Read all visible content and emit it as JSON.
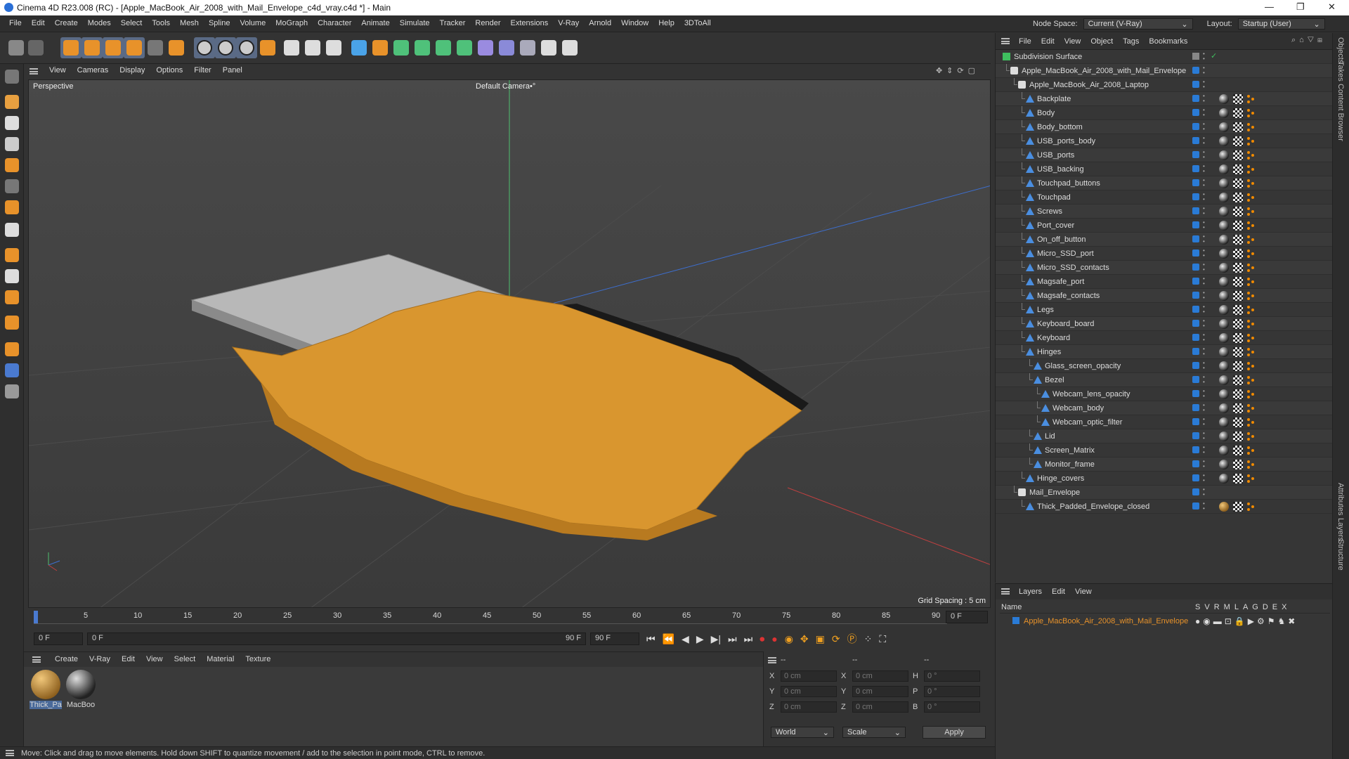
{
  "titlebar": {
    "title": "Cinema 4D R23.008 (RC) - [Apple_MacBook_Air_2008_with_Mail_Envelope_c4d_vray.c4d *] - Main",
    "minimize": "—",
    "maximize": "❐",
    "close": "✕"
  },
  "menubar": {
    "items": [
      "File",
      "Edit",
      "Create",
      "Modes",
      "Select",
      "Tools",
      "Mesh",
      "Spline",
      "Volume",
      "MoGraph",
      "Character",
      "Animate",
      "Simulate",
      "Tracker",
      "Render",
      "Extensions",
      "V-Ray",
      "Arnold",
      "Window",
      "Help",
      "3DToAll"
    ],
    "node_space_label": "Node Space:",
    "node_space_value": "Current (V-Ray)",
    "layout_label": "Layout:",
    "layout_value": "Startup (User)"
  },
  "toolbar_icons": [
    "undo-icon",
    "redo-icon",
    "select-icon",
    "move-icon",
    "scale-icon",
    "rotate-icon",
    "recent-icon",
    "transform-icon",
    "x-axis-icon",
    "y-axis-icon",
    "z-axis-icon",
    "coord-system-icon",
    "render-view-icon",
    "render-icon",
    "render-settings-icon",
    "cube-icon",
    "pen-icon",
    "subdivision-icon",
    "extrude-icon",
    "cloner-icon",
    "instance-icon",
    "deformer-icon",
    "field-icon",
    "floor-icon",
    "camera-icon",
    "light-icon"
  ],
  "viewport": {
    "menu": [
      "View",
      "Cameras",
      "Display",
      "Options",
      "Filter",
      "Panel"
    ],
    "label": "Perspective",
    "camera": "Default Camera",
    "camera_suffix": "•°",
    "grid_spacing": "Grid Spacing : 5 cm"
  },
  "timeline": {
    "ticks": [
      "0",
      "5",
      "10",
      "15",
      "20",
      "25",
      "30",
      "35",
      "40",
      "45",
      "50",
      "55",
      "60",
      "65",
      "70",
      "75",
      "80",
      "85",
      "90"
    ],
    "current_frame_right": "0 F",
    "start_field": "0 F",
    "range_start": "0 F",
    "range_end": "90 F",
    "end_field": "90 F"
  },
  "material_manager": {
    "menu": [
      "Create",
      "V-Ray",
      "Edit",
      "View",
      "Select",
      "Material",
      "Texture"
    ],
    "materials": [
      {
        "label": "Thick_Pa",
        "color": "#c78a2e"
      },
      {
        "label": "MacBoo",
        "color": "#555"
      }
    ]
  },
  "coords": {
    "headers": [
      "--",
      "--",
      "--"
    ],
    "rows": [
      {
        "a": "X",
        "av": "0 cm",
        "b": "X",
        "bv": "0 cm",
        "c": "H",
        "cv": "0 °"
      },
      {
        "a": "Y",
        "av": "0 cm",
        "b": "Y",
        "bv": "0 cm",
        "c": "P",
        "cv": "0 °"
      },
      {
        "a": "Z",
        "av": "0 cm",
        "b": "Z",
        "bv": "0 cm",
        "c": "B",
        "cv": "0 °"
      }
    ],
    "world": "World",
    "scale": "Scale",
    "apply": "Apply"
  },
  "statusbar": {
    "text": "Move: Click and drag to move elements. Hold down SHIFT to quantize movement / add to the selection in point mode, CTRL to remove."
  },
  "object_manager": {
    "menu": [
      "File",
      "Edit",
      "View",
      "Object",
      "Tags",
      "Bookmarks"
    ],
    "objects": [
      {
        "name": "Subdivision Surface",
        "indent": 0,
        "type": "subd",
        "tags": "check"
      },
      {
        "name": "Apple_MacBook_Air_2008_with_Mail_Envelope",
        "indent": 1,
        "type": "null",
        "tags": "none"
      },
      {
        "name": "Apple_MacBook_Air_2008_Laptop",
        "indent": 2,
        "type": "null",
        "tags": "none"
      },
      {
        "name": "Backplate",
        "indent": 3,
        "type": "poly",
        "tags": "mat"
      },
      {
        "name": "Body",
        "indent": 3,
        "type": "poly",
        "tags": "mat"
      },
      {
        "name": "Body_bottom",
        "indent": 3,
        "type": "poly",
        "tags": "mat"
      },
      {
        "name": "USB_ports_body",
        "indent": 3,
        "type": "poly",
        "tags": "mat"
      },
      {
        "name": "USB_ports",
        "indent": 3,
        "type": "poly",
        "tags": "mat"
      },
      {
        "name": "USB_backing",
        "indent": 3,
        "type": "poly",
        "tags": "mat"
      },
      {
        "name": "Touchpad_buttons",
        "indent": 3,
        "type": "poly",
        "tags": "mat"
      },
      {
        "name": "Touchpad",
        "indent": 3,
        "type": "poly",
        "tags": "mat"
      },
      {
        "name": "Screws",
        "indent": 3,
        "type": "poly",
        "tags": "mat"
      },
      {
        "name": "Port_cover",
        "indent": 3,
        "type": "poly",
        "tags": "mat"
      },
      {
        "name": "On_off_button",
        "indent": 3,
        "type": "poly",
        "tags": "mat"
      },
      {
        "name": "Micro_SSD_port",
        "indent": 3,
        "type": "poly",
        "tags": "mat"
      },
      {
        "name": "Micro_SSD_contacts",
        "indent": 3,
        "type": "poly",
        "tags": "mat"
      },
      {
        "name": "Magsafe_port",
        "indent": 3,
        "type": "poly",
        "tags": "mat"
      },
      {
        "name": "Magsafe_contacts",
        "indent": 3,
        "type": "poly",
        "tags": "mat"
      },
      {
        "name": "Legs",
        "indent": 3,
        "type": "poly",
        "tags": "mat"
      },
      {
        "name": "Keyboard_board",
        "indent": 3,
        "type": "poly",
        "tags": "mat"
      },
      {
        "name": "Keyboard",
        "indent": 3,
        "type": "poly",
        "tags": "mat"
      },
      {
        "name": "Hinges",
        "indent": 3,
        "type": "poly",
        "tags": "mat"
      },
      {
        "name": "Glass_screen_opacity",
        "indent": 4,
        "type": "poly",
        "tags": "mat"
      },
      {
        "name": "Bezel",
        "indent": 4,
        "type": "poly",
        "tags": "mat"
      },
      {
        "name": "Webcam_lens_opacity",
        "indent": 5,
        "type": "poly",
        "tags": "mat"
      },
      {
        "name": "Webcam_body",
        "indent": 5,
        "type": "poly",
        "tags": "mat"
      },
      {
        "name": "Webcam_optic_filter",
        "indent": 5,
        "type": "poly",
        "tags": "mat"
      },
      {
        "name": "Lid",
        "indent": 4,
        "type": "poly",
        "tags": "mat"
      },
      {
        "name": "Screen_Matrix",
        "indent": 4,
        "type": "poly",
        "tags": "mat"
      },
      {
        "name": "Monitor_frame",
        "indent": 4,
        "type": "poly",
        "tags": "mat"
      },
      {
        "name": "Hinge_covers",
        "indent": 3,
        "type": "poly",
        "tags": "mat"
      },
      {
        "name": "Mail_Envelope",
        "indent": 2,
        "type": "null",
        "tags": "none"
      },
      {
        "name": "Thick_Padded_Envelope_closed",
        "indent": 3,
        "type": "poly",
        "tags": "env"
      }
    ]
  },
  "layers": {
    "menu": [
      "Layers",
      "Edit",
      "View"
    ],
    "name_header": "Name",
    "flags": [
      "S",
      "V",
      "R",
      "M",
      "L",
      "A",
      "G",
      "D",
      "E",
      "X"
    ],
    "layer_name": "Apple_MacBook_Air_2008_with_Mail_Envelope",
    "layer_color": "#2a7bd6"
  },
  "side_tabs": [
    "Objects",
    "Takes",
    "Content Browser",
    "Attributes",
    "Layers",
    "Structure"
  ],
  "colors": {
    "accent": "#2a7bd6",
    "envelope": "#d9962f",
    "laptop": "#b8b8b8",
    "layer_text": "#e8922a"
  }
}
